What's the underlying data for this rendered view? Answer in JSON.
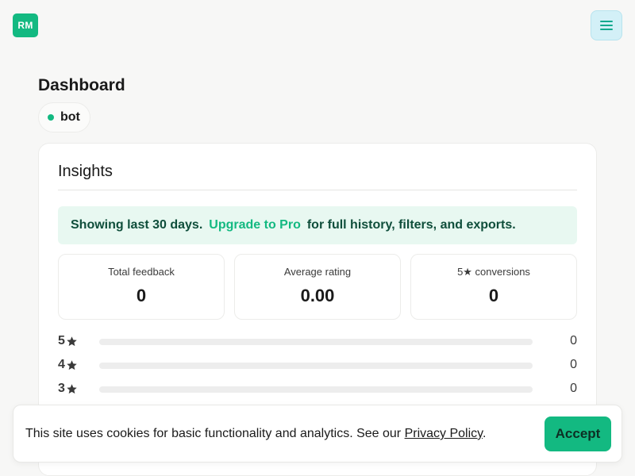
{
  "header": {
    "logo_text": "RM",
    "menu_icon": "hamburger-icon"
  },
  "page": {
    "title": "Dashboard",
    "bot_label": "bot"
  },
  "insights": {
    "title": "Insights",
    "banner": {
      "prefix": "Showing last 30 days.",
      "link": "Upgrade to Pro",
      "suffix": "for full history, filters, and exports."
    },
    "stats": [
      {
        "label": "Total feedback",
        "value": "0"
      },
      {
        "label": "Average rating",
        "value": "0.00"
      },
      {
        "label": "5★ conversions",
        "value": "0"
      }
    ],
    "distribution": [
      {
        "label": "5",
        "count": "0",
        "fraction": 0
      },
      {
        "label": "4",
        "count": "0",
        "fraction": 0
      },
      {
        "label": "3",
        "count": "0",
        "fraction": 0
      }
    ]
  },
  "cookie": {
    "text": "This site uses cookies for basic functionality and analytics. See our",
    "policy_link": "Privacy Policy",
    "period": ".",
    "accept_label": "Accept"
  },
  "colors": {
    "accent": "#13b981",
    "menu_bg": "#d3f0f7",
    "banner_bg": "#e8f8f1",
    "bar_track": "#ededed"
  }
}
